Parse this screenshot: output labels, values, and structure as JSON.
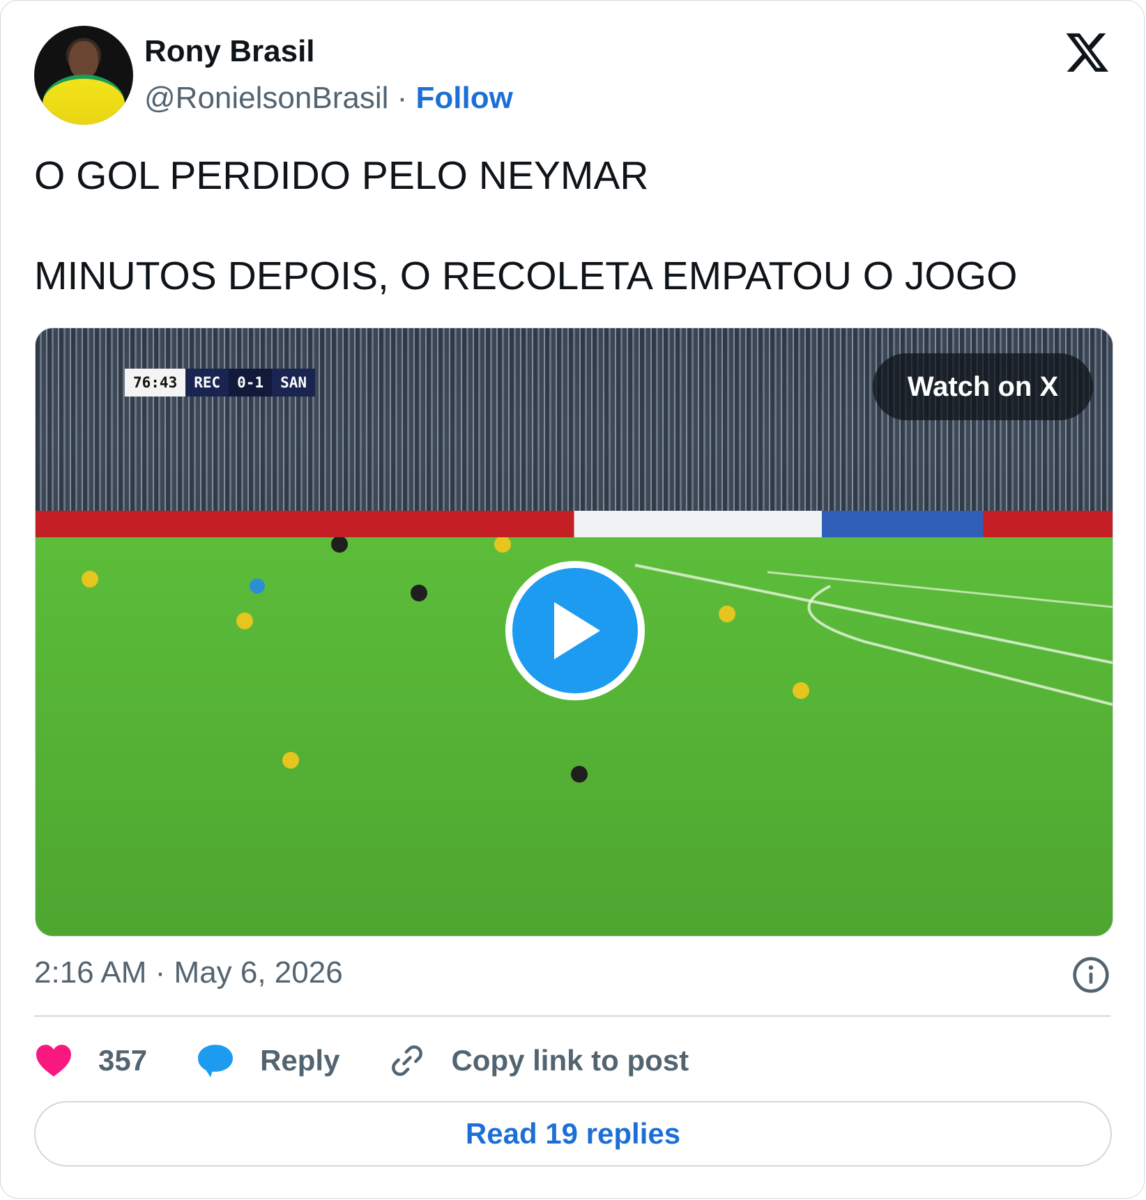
{
  "author": {
    "name": "Rony Brasil",
    "handle": "@RonielsonBrasil",
    "separator": "·",
    "follow_label": "Follow"
  },
  "post": {
    "line1": "O GOL PERDIDO PELO NEYMAR",
    "line2": "MINUTOS DEPOIS, O RECOLETA EMPATOU O JOGO"
  },
  "media": {
    "watch_label": "Watch on X",
    "scorebug": {
      "time": "76:43",
      "home": "REC",
      "score": "0-1",
      "away": "SAN"
    }
  },
  "meta": {
    "timestamp": "2:16 AM · May 6, 2026"
  },
  "actions": {
    "likes": "357",
    "reply_label": "Reply",
    "copy_label": "Copy link to post"
  },
  "read_replies_label": "Read 19 replies",
  "colors": {
    "accent": "#1d6fd6",
    "like": "#f91880",
    "reply": "#1d9bf0",
    "muted": "#536471"
  },
  "icons": [
    "x-logo-icon",
    "play-icon",
    "info-icon",
    "heart-icon",
    "reply-bubble-icon",
    "link-icon"
  ]
}
